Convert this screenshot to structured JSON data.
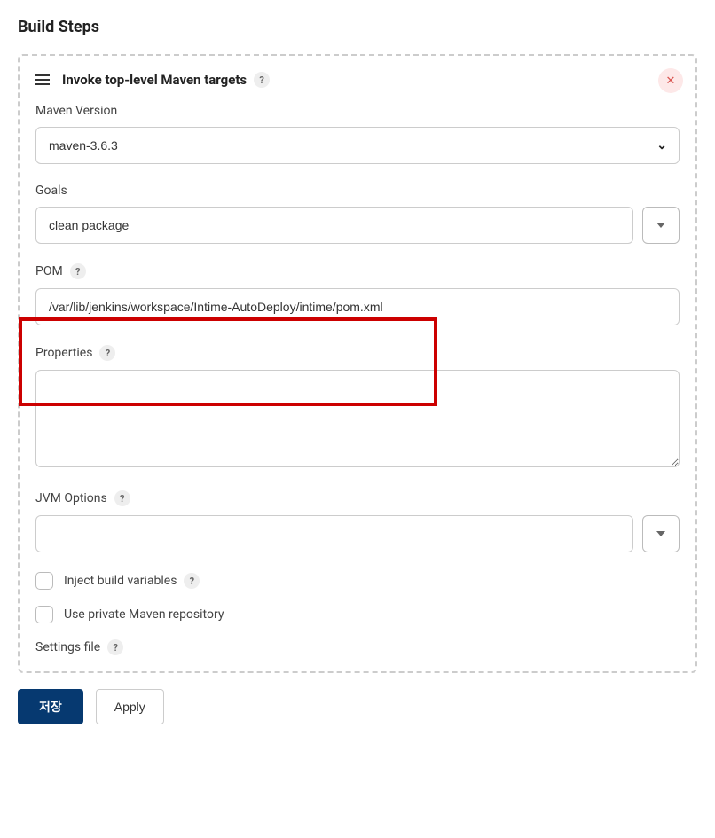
{
  "section_title": "Build Steps",
  "step": {
    "title": "Invoke top-level Maven targets",
    "maven_version": {
      "label": "Maven Version",
      "value": "maven-3.6.3"
    },
    "goals": {
      "label": "Goals",
      "value": "clean package"
    },
    "pom": {
      "label": "POM",
      "value": "/var/lib/jenkins/workspace/Intime-AutoDeploy/intime/pom.xml"
    },
    "properties": {
      "label": "Properties",
      "value": ""
    },
    "jvm_options": {
      "label": "JVM Options",
      "value": ""
    },
    "inject_build_vars": {
      "label": "Inject build variables",
      "checked": false
    },
    "private_repo": {
      "label": "Use private Maven repository",
      "checked": false
    },
    "settings_file": {
      "label": "Settings file"
    }
  },
  "buttons": {
    "save": "저장",
    "apply": "Apply"
  },
  "help_glyph": "?",
  "remove_glyph": "✕"
}
